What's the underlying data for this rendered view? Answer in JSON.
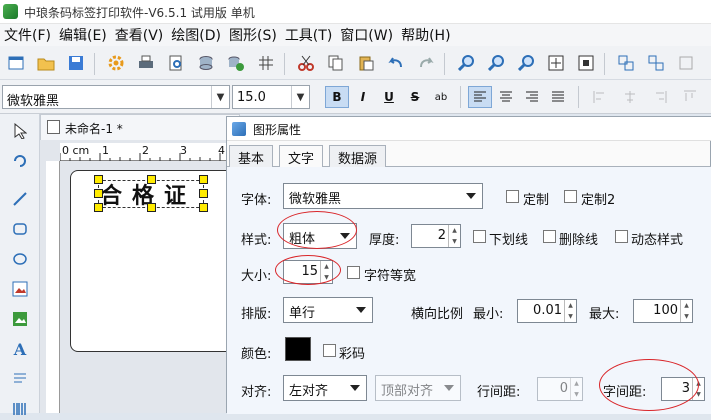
{
  "titlebar": {
    "title": "中琅条码标签打印软件-V6.5.1 试用版 单机"
  },
  "menu": [
    "文件(F)",
    "编辑(E)",
    "查看(V)",
    "绘图(D)",
    "图形(S)",
    "工具(T)",
    "窗口(W)",
    "帮助(H)"
  ],
  "font_toolbar": {
    "font_name": "微软雅黑",
    "font_size": "15.0"
  },
  "document": {
    "tab_title": "未命名-1 *",
    "label_text": "合格证",
    "ruler_labels": [
      "0 cm",
      "1",
      "2",
      "3",
      "4"
    ]
  },
  "dialog": {
    "title": "图形属性",
    "tabs": [
      "基本",
      "文字",
      "数据源"
    ],
    "active_tab": "文字",
    "font_label": "字体:",
    "font_value": "微软雅黑",
    "custom_label": "定制",
    "custom2_label": "定制2",
    "style_label": "样式:",
    "style_value": "粗体",
    "thickness_label": "厚度:",
    "thickness_value": "2",
    "underline_label": "下划线",
    "strike_label": "删除线",
    "dynamic_label": "动态样式",
    "size_label": "大小:",
    "size_value": "15",
    "equal_width_label": "字符等宽",
    "layout_label": "排版:",
    "layout_value": "单行",
    "hscale_label": "横向比例",
    "min_label": "最小:",
    "min_value": "0.01",
    "max_label": "最大:",
    "max_value": "100",
    "color_label": "颜色:",
    "color_value": "#000000",
    "colorcode_label": "彩码",
    "align_label": "对齐:",
    "align_value": "左对齐",
    "valign_value": "顶部对齐",
    "line_spacing_label": "行间距:",
    "line_spacing_value": "0",
    "char_spacing_label": "字间距:",
    "char_spacing_value": "3"
  }
}
